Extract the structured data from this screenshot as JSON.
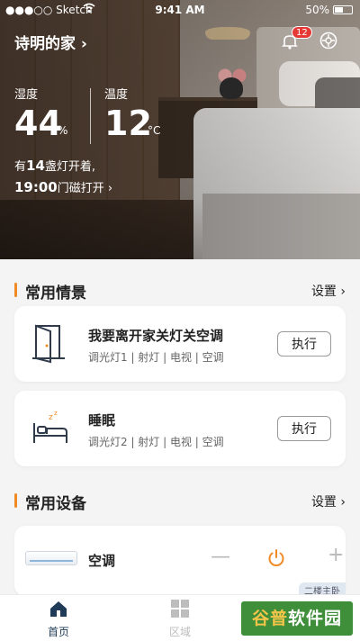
{
  "status_bar": {
    "carrier": "●●●○○ Sketch",
    "time": "9:41 AM",
    "battery_pct": "50%",
    "battery_level": 0.5
  },
  "header": {
    "home_title": "诗明的家 ›",
    "notification_count": "12"
  },
  "metrics": {
    "humidity_label": "湿度",
    "humidity_value": "44",
    "humidity_unit": "%",
    "temp_label": "温度",
    "temp_value": "12",
    "temp_unit": "°C"
  },
  "info": {
    "lights_prefix": "有",
    "lights_count": "14",
    "lights_suffix": "盏灯开着,",
    "door_time": "19:00",
    "door_text": "门磁打开 ›"
  },
  "scenes_section": {
    "title": "常用情景",
    "settings": "设置 ›"
  },
  "scenes": [
    {
      "name": "我要离开家关灯关空调",
      "desc": "调光灯1 | 射灯 | 电视 | 空调",
      "action": "执行",
      "icon": "door-icon"
    },
    {
      "name": "睡眠",
      "desc": "调光灯2 | 射灯 | 电视 | 空调",
      "action": "执行",
      "icon": "bed-sleep-icon"
    }
  ],
  "devices_section": {
    "title": "常用设备",
    "settings": "设置 ›"
  },
  "devices": [
    {
      "name": "空调",
      "minus": "—",
      "plus": "+",
      "tag": "二楼主卧",
      "icon": "air-conditioner-icon"
    }
  ],
  "tabs": [
    {
      "label": "首页",
      "active": true,
      "icon": "home-icon"
    },
    {
      "label": "区域",
      "active": false,
      "icon": "area-grid-icon"
    }
  ],
  "watermark": {
    "part1": "谷普",
    "part2": "软件园"
  },
  "colors": {
    "accent": "#f08a24",
    "active_tab": "#1f3b57",
    "inactive_tab": "#bdbdbd",
    "badge": "#e53935"
  }
}
